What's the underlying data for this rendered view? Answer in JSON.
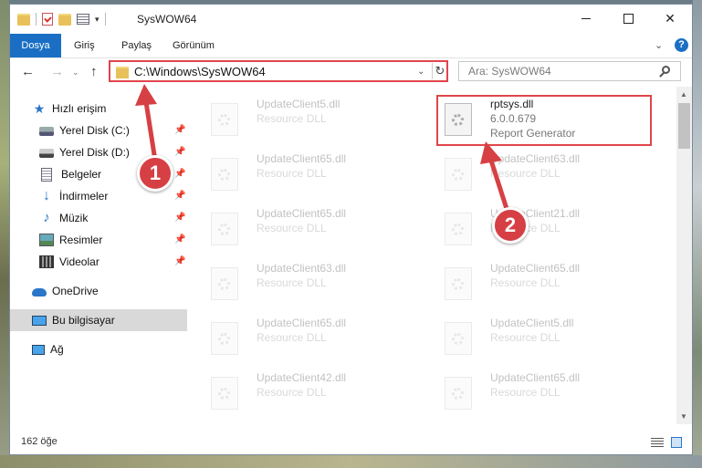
{
  "window": {
    "title": "SysWOW64",
    "controls": {
      "minimize_icon": "minimize-icon",
      "maximize_icon": "maximize-icon",
      "close_icon": "close-icon",
      "close_glyph": "✕"
    }
  },
  "ribbon": {
    "tabs": [
      {
        "label": "Dosya",
        "active": true
      },
      {
        "label": "Giriş"
      },
      {
        "label": "Paylaş"
      },
      {
        "label": "Görünüm"
      }
    ],
    "expand_glyph": "⌄",
    "help_glyph": "?"
  },
  "address": {
    "path": "C:\\Windows\\SysWOW64",
    "refresh_glyph": "↻",
    "dropdown_glyph": "⌄",
    "back_glyph": "←",
    "forward_glyph": "→",
    "up_glyph": "↑",
    "recent_glyph": "⌄"
  },
  "search": {
    "placeholder": "Ara: SysWOW64"
  },
  "navpane": {
    "quick_access": "Hızlı erişim",
    "items": [
      {
        "label": "Yerel Disk (C:)",
        "icon": "disk-icon",
        "pinned": true
      },
      {
        "label": "Yerel Disk (D:)",
        "icon": "disk-icon",
        "pinned": true
      },
      {
        "label": "Belgeler",
        "icon": "documents-icon",
        "pinned": true
      },
      {
        "label": "İndirmeler",
        "icon": "downloads-icon",
        "pinned": true
      },
      {
        "label": "Müzik",
        "icon": "music-icon",
        "pinned": true
      },
      {
        "label": "Resimler",
        "icon": "pictures-icon",
        "pinned": true
      },
      {
        "label": "Videolar",
        "icon": "videos-icon",
        "pinned": true
      }
    ],
    "onedrive": "OneDrive",
    "this_pc": "Bu bilgisayar",
    "network": "Ağ",
    "pin_glyph": "📌"
  },
  "files": {
    "left_column": [
      {
        "name": "UpdateClient5.dll",
        "type": "Resource DLL"
      },
      {
        "name": "UpdateClient65.dll",
        "type": "Resource DLL"
      },
      {
        "name": "UpdateClient65.dll",
        "type": "Resource DLL"
      },
      {
        "name": "UpdateClient63.dll",
        "type": "Resource DLL"
      },
      {
        "name": "UpdateClient65.dll",
        "type": "Resource DLL"
      },
      {
        "name": "UpdateClient42.dll",
        "type": "Resource DLL"
      }
    ],
    "right_column": [
      {
        "name": "rptsys.dll",
        "version": "6.0.0.679",
        "type": "Report Generator",
        "highlighted": true
      },
      {
        "name": "UpdateClient63.dll",
        "type": "Resource DLL"
      },
      {
        "name": "UpdateClient21.dll",
        "type": "Resource DLL"
      },
      {
        "name": "UpdateClient65.dll",
        "type": "Resource DLL"
      },
      {
        "name": "UpdateClient5.dll",
        "type": "Resource DLL"
      },
      {
        "name": "UpdateClient65.dll",
        "type": "Resource DLL"
      }
    ]
  },
  "status": {
    "count": "162 öğe"
  },
  "annotations": {
    "step1": "1",
    "step2": "2",
    "color": "#d64045"
  }
}
